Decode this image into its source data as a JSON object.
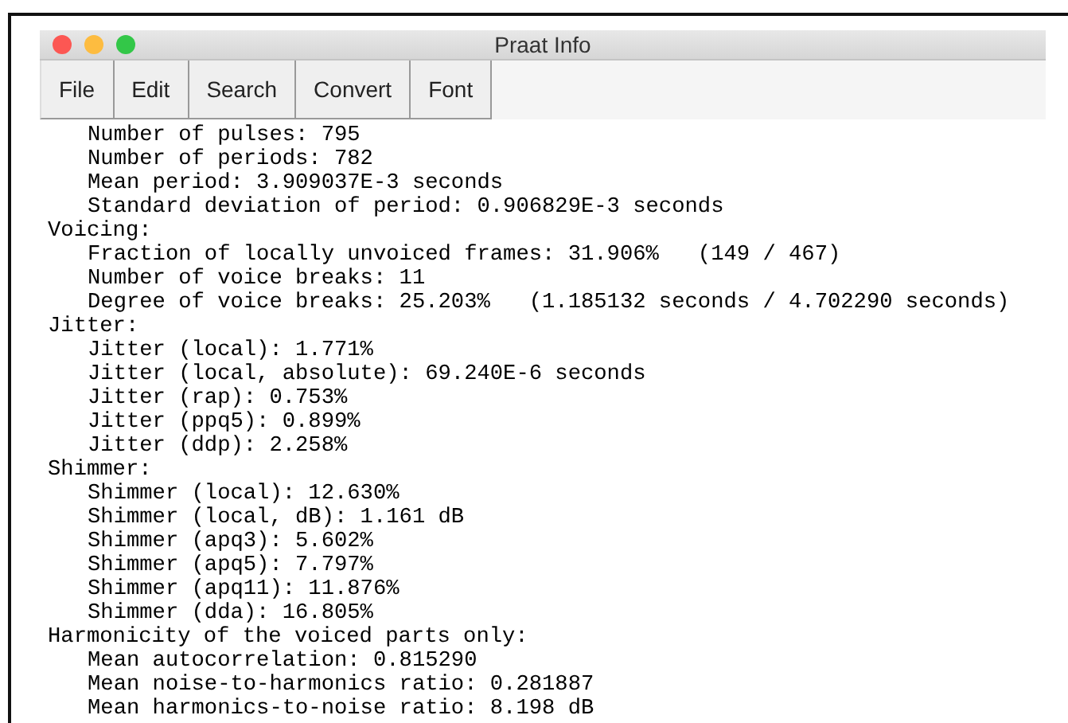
{
  "window": {
    "title": "Praat Info"
  },
  "menu": [
    {
      "label": "File"
    },
    {
      "label": "Edit"
    },
    {
      "label": "Search"
    },
    {
      "label": "Convert"
    },
    {
      "label": "Font"
    }
  ],
  "sections": [
    {
      "lines": [
        "Number of pulses: 795",
        "Number of periods: 782",
        "Mean period: 3.909037E-3 seconds",
        "Standard deviation of period: 0.906829E-3 seconds"
      ]
    },
    {
      "title": "Voicing:",
      "lines": [
        "Fraction of locally unvoiced frames: 31.906%   (149 / 467)",
        "Number of voice breaks: 11",
        "Degree of voice breaks: 25.203%   (1.185132 seconds / 4.702290 seconds)"
      ]
    },
    {
      "title": "Jitter:",
      "lines": [
        "Jitter (local): 1.771%",
        "Jitter (local, absolute): 69.240E-6 seconds",
        "Jitter (rap): 0.753%",
        "Jitter (ppq5): 0.899%",
        "Jitter (ddp): 2.258%"
      ]
    },
    {
      "title": "Shimmer:",
      "lines": [
        "Shimmer (local): 12.630%",
        "Shimmer (local, dB): 1.161 dB",
        "Shimmer (apq3): 5.602%",
        "Shimmer (apq5): 7.797%",
        "Shimmer (apq11): 11.876%",
        "Shimmer (dda): 16.805%"
      ]
    },
    {
      "title": "Harmonicity of the voiced parts only:",
      "lines": [
        "Mean autocorrelation: 0.815290",
        "Mean noise-to-harmonics ratio: 0.281887",
        "Mean harmonics-to-noise ratio: 8.198 dB"
      ]
    }
  ]
}
